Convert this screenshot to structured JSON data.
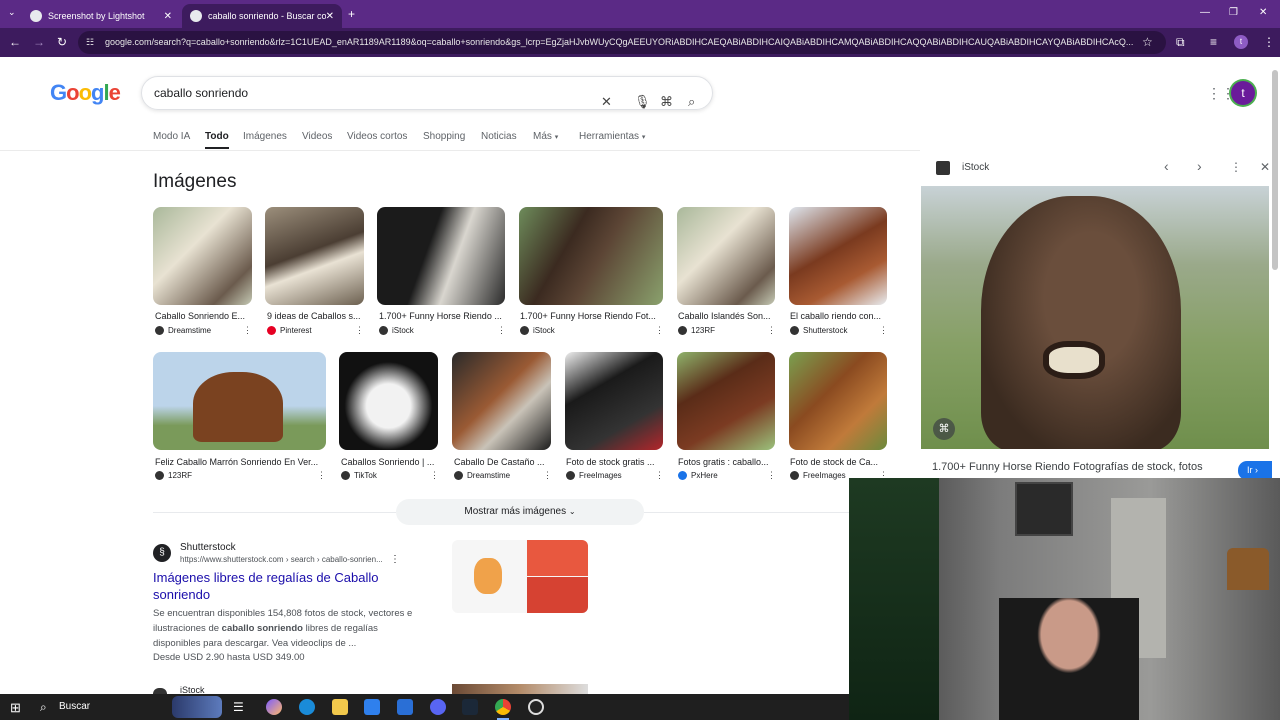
{
  "tabs": [
    {
      "label": "Screenshot by Lightshot"
    },
    {
      "label": "caballo sonriendo - Buscar con Google"
    }
  ],
  "url": "google.com/search?q=caballo+sonriendo&rlz=1C1UEAD_enAR1189AR1189&oq=caballo+sonriendo&gs_lcrp=EgZjaHJvbWUyCQgAEEUYORiABDIHCAEQABiABDIHCAIQABiABDIHCAMQABiABDIHCAQQABiABDIHCAUQABiABDIHCAYQABiABDIHCAcQ...",
  "search": {
    "query": "caballo sonriendo"
  },
  "avatar": "t",
  "nav": [
    "Modo IA",
    "Todo",
    "Imágenes",
    "Videos",
    "Videos cortos",
    "Shopping",
    "Noticias",
    "Más",
    "Herramientas"
  ],
  "images_heading": "Imágenes",
  "row1": [
    {
      "caption": "Caballo Sonriendo E...",
      "source": "Dreamstime"
    },
    {
      "caption": "9 ideas de Caballos s...",
      "source": "Pinterest"
    },
    {
      "caption": "1.700+ Funny Horse Riendo ...",
      "source": "iStock"
    },
    {
      "caption": "1.700+ Funny Horse Riendo Fot...",
      "source": "iStock"
    },
    {
      "caption": "Caballo Islandés Son...",
      "source": "123RF"
    },
    {
      "caption": "El caballo riendo con...",
      "source": "Shutterstock"
    }
  ],
  "row2": [
    {
      "caption": "Feliz Caballo Marrón Sonriendo En Ver...",
      "source": "123RF"
    },
    {
      "caption": "Caballos Sonriendo | ...",
      "source": "TikTok"
    },
    {
      "caption": "Caballo De Castaño ...",
      "source": "Dreamstime"
    },
    {
      "caption": "Foto de stock gratis ...",
      "source": "FreeImages"
    },
    {
      "caption": "Fotos gratis : caballo...",
      "source": "PxHere"
    },
    {
      "caption": "Foto de stock de Ca...",
      "source": "FreeImages"
    }
  ],
  "more_button": "Mostrar más imágenes",
  "result": {
    "site": "Shutterstock",
    "url": "https://www.shutterstock.com › search › caballo-sonrien...",
    "title": "Imágenes libres de regalías de Caballo sonriendo",
    "snippet_pre": "Se encuentran disponibles 154,808 fotos de stock, vectores e ilustraciones de ",
    "snippet_bold": "caballo sonriendo",
    "snippet_post": " libres de regalías disponibles para descargar. Vea videoclips de ...",
    "price": "Desde USD 2.90 hasta USD 349.00"
  },
  "result2_site": "iStock",
  "panel": {
    "source": "iStock",
    "caption": "1.700+ Funny Horse Riendo Fotografías de stock, fotos",
    "button": "Ir"
  },
  "taskbar": {
    "search": "Buscar"
  }
}
